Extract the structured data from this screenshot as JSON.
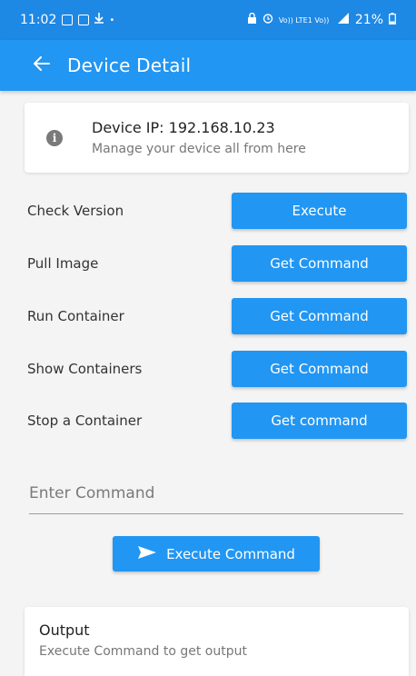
{
  "status_bar": {
    "time": "11:02",
    "dot": "•",
    "network_text": "Vo)) LTE1 Vo)) LTE2",
    "battery": "21%"
  },
  "app_bar": {
    "back_icon": "arrow-left-icon",
    "title": "Device Detail"
  },
  "info_card": {
    "icon": "info-icon",
    "icon_glyph": "i",
    "title": "Device IP: 192.168.10.23",
    "subtitle": "Manage your device all from here"
  },
  "commands": [
    {
      "label": "Check Version",
      "button": "Execute"
    },
    {
      "label": "Pull Image",
      "button": "Get Command"
    },
    {
      "label": "Run Container",
      "button": "Get Command"
    },
    {
      "label": "Show Containers",
      "button": "Get Command"
    },
    {
      "label": "Stop a Container",
      "button": "Get command"
    }
  ],
  "command_input": {
    "placeholder": "Enter Command",
    "value": ""
  },
  "execute_command": {
    "icon": "send-icon",
    "label": "Execute Command"
  },
  "output": {
    "title": "Output",
    "subtitle": "Execute Command to get output"
  },
  "colors": {
    "primary": "#2196f3",
    "status_bar": "#1e88e5",
    "background": "#f4f4f4"
  }
}
